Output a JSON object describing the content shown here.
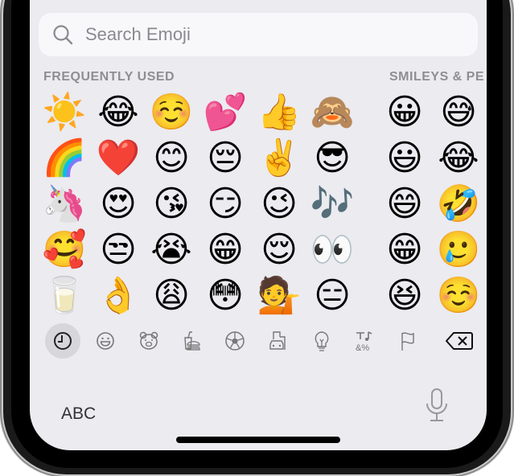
{
  "search": {
    "placeholder": "Search Emoji",
    "icon": "search-icon"
  },
  "sections": {
    "frequently_used": "FREQUENTLY USED",
    "smileys": "SMILEYS & PE"
  },
  "frequently_used": [
    [
      "☀️",
      "😂",
      "☺️",
      "💕",
      "👍",
      "🙈"
    ],
    [
      "🌈",
      "❤️",
      "😊",
      "😔",
      "✌️",
      "😎"
    ],
    [
      "🦄",
      "😍",
      "😘",
      "😏",
      "😉",
      "🎶"
    ],
    [
      "🥰",
      "😒",
      "😭",
      "😁",
      "😌",
      "👀"
    ],
    [
      "🥛",
      "👌",
      "😩",
      "😳",
      "💁",
      "😑"
    ]
  ],
  "smileys": [
    [
      "😀",
      "😅"
    ],
    [
      "😃",
      "😂"
    ],
    [
      "😄",
      "🤣"
    ],
    [
      "😁",
      "🥲"
    ],
    [
      "😆",
      "☺️"
    ]
  ],
  "categories": [
    {
      "name": "recent-clock-icon",
      "active": true
    },
    {
      "name": "smiley-icon",
      "active": false
    },
    {
      "name": "animal-bear-icon",
      "active": false
    },
    {
      "name": "food-icon",
      "active": false
    },
    {
      "name": "soccer-ball-icon",
      "active": false
    },
    {
      "name": "travel-car-icon",
      "active": false
    },
    {
      "name": "lightbulb-icon",
      "active": false
    },
    {
      "name": "symbols-icon",
      "active": false
    },
    {
      "name": "flag-icon",
      "active": false
    },
    {
      "name": "delete-backspace-icon",
      "active": false
    }
  ],
  "bottom": {
    "abc_label": "ABC",
    "mic_icon": "microphone-icon"
  },
  "colors": {
    "background": "#ebebf0",
    "search_bg": "#f8f8fb",
    "label_gray": "#8e8e93",
    "active_cat": "#d6d6db"
  }
}
